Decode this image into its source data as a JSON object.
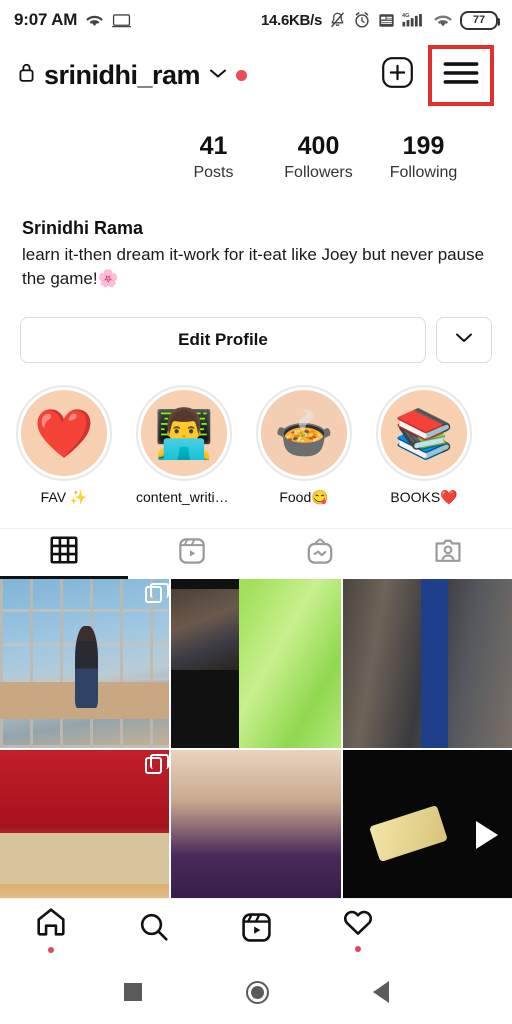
{
  "status_bar": {
    "time": "9:07 AM",
    "wifi_icon": "wifi-icon",
    "cast_icon": "screencast-icon",
    "network_speed": "14.6KB/s",
    "mute_icon": "bell-muted-icon",
    "alarm_icon": "alarm-clock-icon",
    "widget_icon": "calendar-widget-icon",
    "signal_icon": "signal-4g-icon",
    "signal_label": "4G",
    "wifi_right_icon": "wifi-icon",
    "battery_level": "77"
  },
  "header": {
    "lock_icon": "lock-icon",
    "username": "srinidhi_ram",
    "chevron_icon": "chevron-down-icon",
    "status_dot_color": "#ed4956",
    "add_icon": "plus-square-icon",
    "menu_icon": "hamburger-menu-icon",
    "highlight_color": "#e03030"
  },
  "stats": [
    {
      "value": "41",
      "label": "Posts"
    },
    {
      "value": "400",
      "label": "Followers"
    },
    {
      "value": "199",
      "label": "Following"
    }
  ],
  "bio": {
    "name": "Srinidhi Rama",
    "text": "learn it-then dream it-work for it-eat like Joey but never pause the game!🌸"
  },
  "actions": {
    "edit_profile_label": "Edit Profile",
    "dropdown_icon": "chevron-down-icon"
  },
  "highlights": [
    {
      "label": "FAV ✨",
      "emoji": "❤️",
      "icon_name": "heart-highlight-cover"
    },
    {
      "label": "content_writin...",
      "emoji": "👨‍💻",
      "icon_name": "laptop-person-highlight-cover"
    },
    {
      "label": "Food😋",
      "emoji": "🍲",
      "icon_name": "stew-bowl-highlight-cover"
    },
    {
      "label": "BOOKS❤️",
      "emoji": "📚",
      "icon_name": "books-highlight-cover"
    }
  ],
  "tabs": [
    {
      "icon_name": "grid-tab-icon",
      "active": true
    },
    {
      "icon_name": "reels-tab-icon",
      "active": false
    },
    {
      "icon_name": "igtv-tab-icon",
      "active": false
    },
    {
      "icon_name": "tagged-tab-icon",
      "active": false
    }
  ],
  "grid_posts": [
    {
      "art": "art1",
      "badge": "multi",
      "alt": "person standing by glass wall with city skyline"
    },
    {
      "art": "art2",
      "badge": "none",
      "alt": "green fabric dress closeup"
    },
    {
      "art": "art3",
      "badge": "none",
      "alt": "clothing rack with blue garment"
    },
    {
      "art": "art4",
      "badge": "multi",
      "alt": "red decorated stage"
    },
    {
      "art": "art5",
      "badge": "none",
      "alt": "person with purple hair"
    },
    {
      "art": "art6",
      "badge": "video",
      "alt": "dark shot of food, video post"
    }
  ],
  "bottom_nav": [
    {
      "icon_name": "home-icon",
      "dot": true
    },
    {
      "icon_name": "search-icon",
      "dot": false
    },
    {
      "icon_name": "reels-icon",
      "dot": false
    },
    {
      "icon_name": "activity-heart-icon",
      "dot": true
    },
    {
      "icon_name": "profile-avatar-icon",
      "dot": false
    }
  ],
  "android_nav": [
    {
      "icon_name": "recents-square-icon"
    },
    {
      "icon_name": "home-circle-icon"
    },
    {
      "icon_name": "back-triangle-icon"
    }
  ]
}
